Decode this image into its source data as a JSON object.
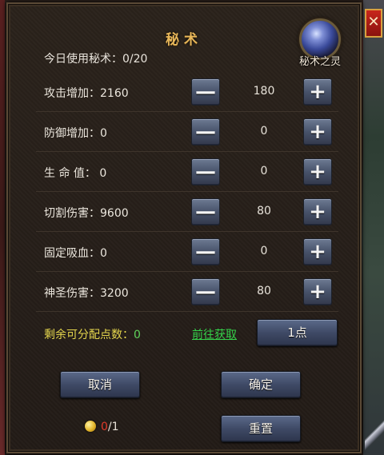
{
  "panel": {
    "title": "秘术",
    "usage_label": "今日使用秘术：",
    "usage_value": "0/20",
    "spirit_label": "秘术之灵",
    "close_glyph": "✕"
  },
  "stats": [
    {
      "label": "攻击增加：2160",
      "value": "180"
    },
    {
      "label": "防御增加：0",
      "value": "0"
    },
    {
      "label": "生 命 值： 0",
      "value": "0"
    },
    {
      "label": "切割伤害：9600",
      "value": "80"
    },
    {
      "label": "固定吸血：0",
      "value": "0"
    },
    {
      "label": "神圣伤害：3200",
      "value": "80"
    }
  ],
  "stepper": {
    "minus_glyph": "—",
    "plus_glyph": "+"
  },
  "points": {
    "label": "剩余可分配点数：",
    "value": "0",
    "goto_link": "前往获取",
    "step_button": "1点"
  },
  "actions": {
    "cancel": "取消",
    "confirm": "确定",
    "reset": "重置"
  },
  "coin": {
    "current": "0",
    "total": "/1"
  },
  "colors": {
    "title": "#e8b75a",
    "points_label": "#e5d64d",
    "link": "#35d14a",
    "coin_current": "#e23a2a",
    "button": "#47526a",
    "close": "#c8261c"
  },
  "icons": [
    "spirit-orb-icon",
    "close-icon",
    "minus-icon",
    "plus-icon",
    "gold-coin-icon"
  ]
}
